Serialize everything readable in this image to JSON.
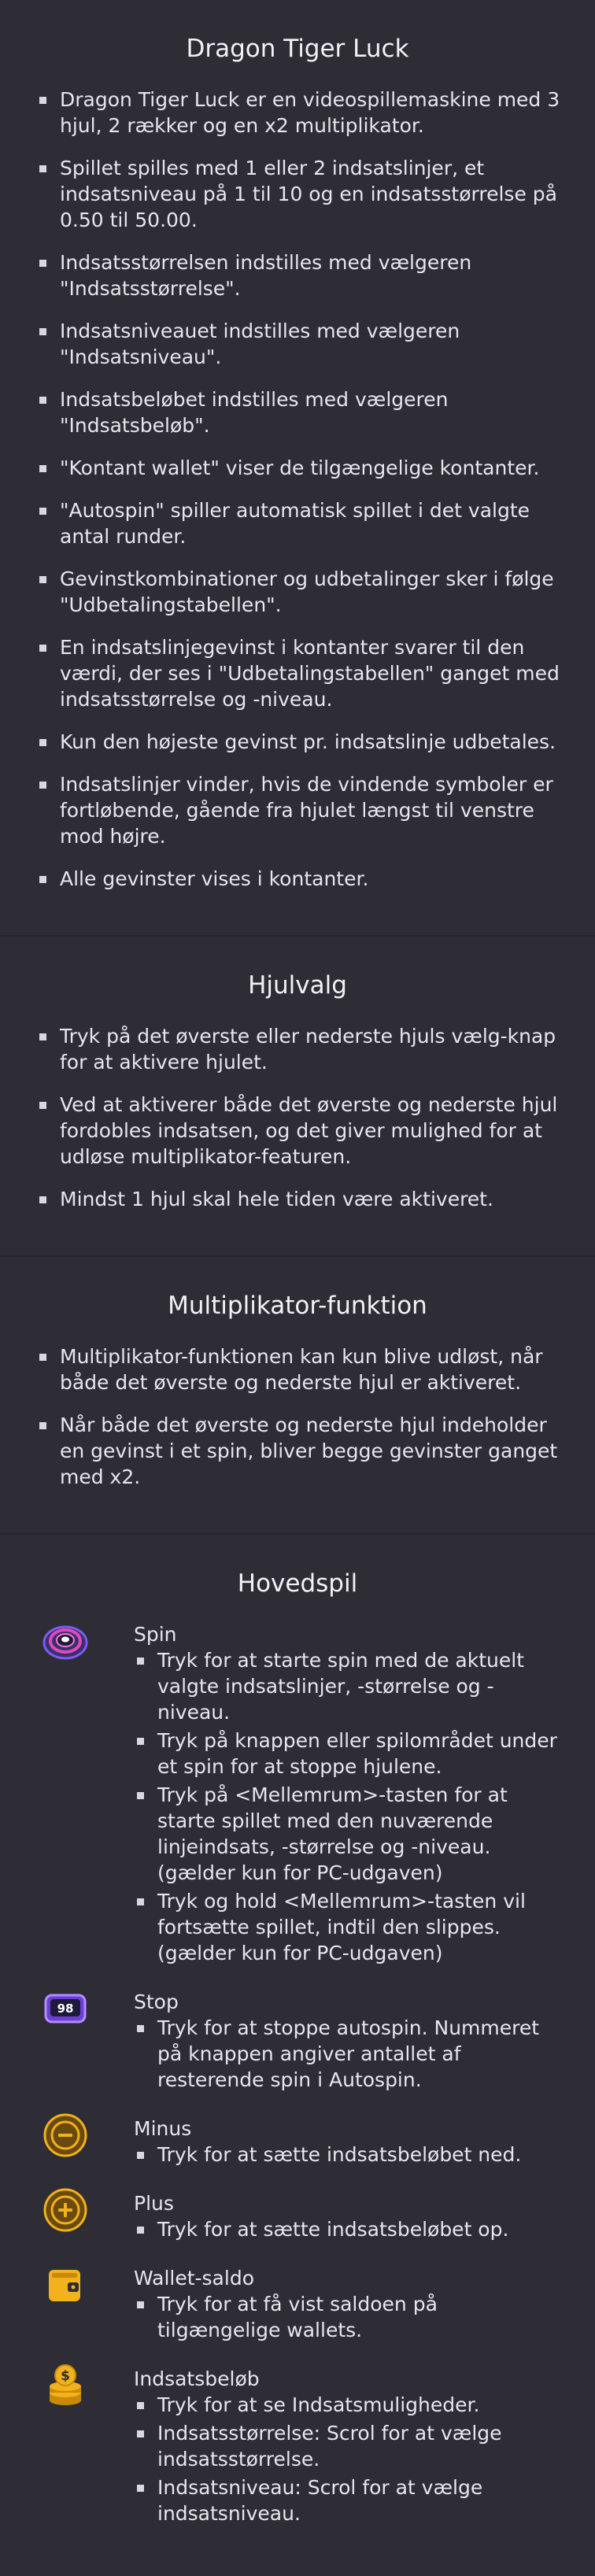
{
  "intro": {
    "title": "Dragon Tiger Luck",
    "items": [
      "Dragon Tiger Luck er en videospillemaskine med 3 hjul, 2 rækker og en x2 multiplikator.",
      "Spillet spilles med 1 eller 2 indsatslinjer, et indsatsniveau på 1 til 10 og en indsatsstørrelse på 0.50 til 50.00.",
      "Indsatsstørrelsen indstilles med vælgeren \"Indsatsstørrelse\".",
      "Indsatsniveauet indstilles med vælgeren \"Indsatsniveau\".",
      "Indsatsbeløbet indstilles med vælgeren \"Indsatsbeløb\".",
      "\"Kontant wallet\" viser de tilgængelige kontanter.",
      "\"Autospin\" spiller automatisk spillet i det valgte antal runder.",
      "Gevinstkombinationer og udbetalinger sker i følge \"Udbetalingstabellen\".",
      "En indsatslinjegevinst i kontanter svarer til den værdi, der ses i \"Udbetalingstabellen\" ganget med indsatsstørrelse og -niveau.",
      "Kun den højeste gevinst pr. indsatslinje udbetales.",
      "Indsatslinjer vinder, hvis de vindende symboler er fortløbende, gående fra hjulet længst til venstre mod højre.",
      "Alle gevinster vises i kontanter."
    ]
  },
  "reels": {
    "title": "Hjulvalg",
    "items": [
      "Tryk på det øverste eller nederste hjuls vælg-knap for at aktivere hjulet.",
      "Ved at aktiverer både det øverste og nederste hjul fordobles indsatsen, og det giver mulighed for at udløse multiplikator-featuren.",
      "Mindst 1 hjul skal hele tiden være aktiveret."
    ]
  },
  "multiplier": {
    "title": "Multiplikator-funktion",
    "items": [
      "Multiplikator-funktionen kan kun blive udløst, når både det øverste og nederste hjul er aktiveret.",
      "Når både det øverste og nederste hjul indeholder en gevinst i et spin, bliver begge gevinster ganget med x2."
    ]
  },
  "main": {
    "title": "Hovedspil",
    "controls": [
      {
        "icon": "spin-icon",
        "name": "Spin",
        "items": [
          "Tryk for at starte spin med de aktuelt valgte indsatslinjer, -størrelse og -niveau.",
          "Tryk på knappen eller spilområdet under et spin for at stoppe hjulene.",
          "Tryk på <Mellemrum>-tasten for at starte spillet med den nuværende linjeindsats, -størrelse og -niveau. (gælder kun for PC-udgaven)",
          "Tryk og hold <Mellemrum>-tasten vil fortsætte spillet, indtil den slippes. (gælder kun for PC-udgaven)"
        ]
      },
      {
        "icon": "stop-autospin-icon",
        "name": "Stop",
        "badge": "98",
        "items": [
          "Tryk for at stoppe autospin. Nummeret på knappen angiver antallet af resterende spin i Autospin."
        ]
      },
      {
        "icon": "minus-icon",
        "name": "Minus",
        "items": [
          "Tryk for at sætte indsatsbeløbet ned."
        ]
      },
      {
        "icon": "plus-icon",
        "name": "Plus",
        "items": [
          "Tryk for at sætte indsatsbeløbet op."
        ]
      },
      {
        "icon": "wallet-icon",
        "name": "Wallet-saldo",
        "items": [
          "Tryk for at få vist saldoen på tilgængelige wallets."
        ]
      },
      {
        "icon": "coins-icon",
        "name": "Indsatsbeløb",
        "items": [
          "Tryk for at se Indsatsmuligheder.",
          "Indsatsstørrelse: Scrol for at vælge indsatsstørrelse.",
          "Indsatsniveau: Scrol for at vælge indsatsniveau."
        ]
      }
    ]
  },
  "colors": {
    "background": "#2e2d36",
    "divider": "#26252d",
    "text": "#e6e6ec",
    "gold": "#f2b21b",
    "purple": "#7d5cf0"
  }
}
